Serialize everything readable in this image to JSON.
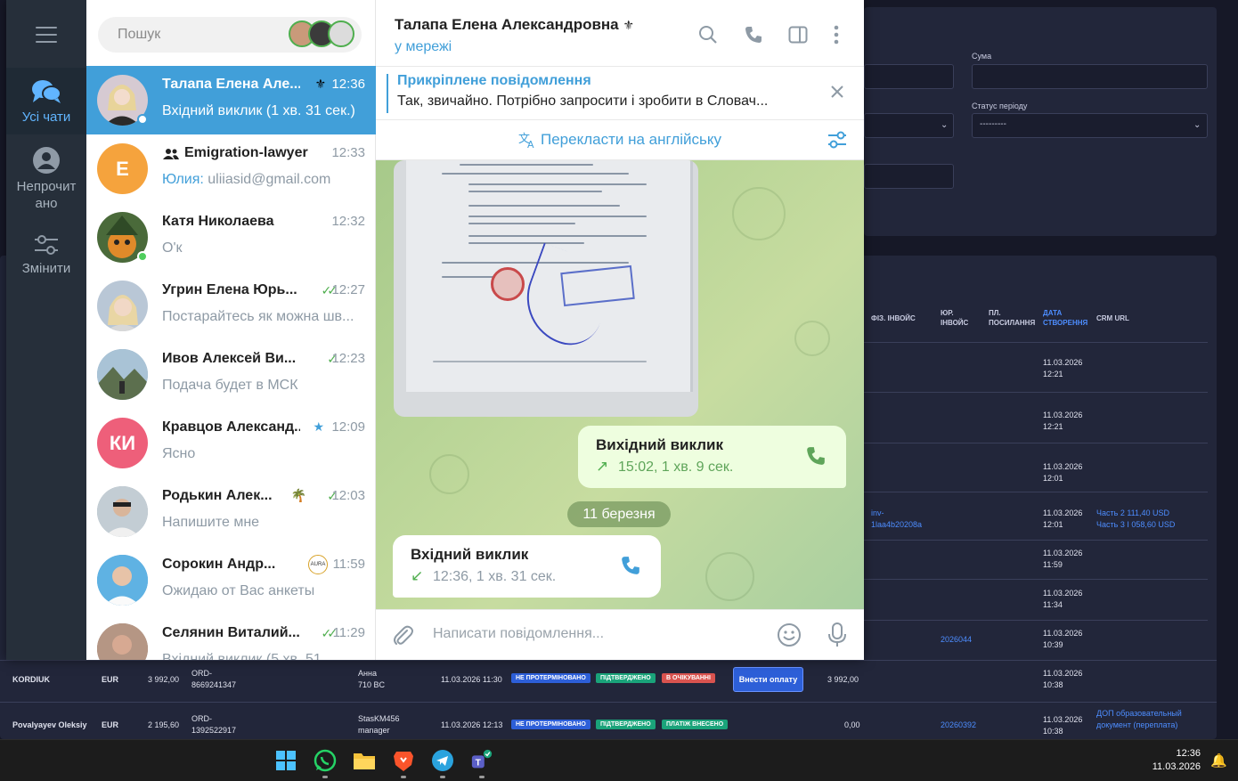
{
  "dashboard": {
    "filter_labels": {
      "sum": "Сума",
      "period_status": "Статус періоду"
    },
    "period_status_value": "---------",
    "columns": {
      "phys_invoice": "ФІЗ. ІНВОЙС",
      "jur_invoice": "ЮР. ІНВОЙС",
      "pay_link": "ПЛ. ПОСИЛАННЯ",
      "created": "ДАТА СТВОРЕННЯ",
      "crm_url": "CRM URL"
    },
    "row_dates": [
      {
        "date": "11.03.2026",
        "time": "12:21"
      },
      {
        "date": "11.03.2026",
        "time": "12:21"
      },
      {
        "date": "11.03.2026",
        "time": "12:01"
      },
      {
        "date": "11.03.2026",
        "time": "12:01"
      },
      {
        "date": "11.03.2026",
        "time": "11:59"
      },
      {
        "date": "11.03.2026",
        "time": "11:34"
      },
      {
        "date": "11.03.2026",
        "time": "10:39"
      },
      {
        "date": "11.03.2026",
        "time": "10:38"
      },
      {
        "date": "11.03.2026",
        "time": "10:38"
      }
    ],
    "inv_link": {
      "line1": "inv-",
      "line2": "1laa4b20208a"
    },
    "crm_parts": {
      "line1": "Часть 2 111,40 USD",
      "line2": "Часть 3 I 058,60 USD"
    },
    "jur_links": {
      "row7": "2026044",
      "row9": "20260392"
    },
    "crm_last": {
      "line1": "ДОП образовательный",
      "line2": "документ (переплата)"
    },
    "rows": [
      {
        "client": "KORDIUK",
        "currency": "EUR",
        "amount": "3 992,00",
        "order": "ORD-",
        "order_id": "8669241347",
        "manager": "Анна",
        "manager2": "710 BC",
        "datetime": "11.03.2026 11:30",
        "badges": [
          "НЕ ПРОТЕРМІНОВАНО",
          "ПІДТВЕРДЖЕНО",
          "В ОЧІКУВАННІ"
        ],
        "pay_button": "Внести оплату",
        "paid": "3 992,00"
      },
      {
        "client": "Povalyayev Oleksiy",
        "currency": "EUR",
        "amount": "2 195,60",
        "order": "ORD-",
        "order_id": "1392522917",
        "manager": "StasKM456",
        "manager2": "manager",
        "datetime": "11.03.2026 12:13",
        "badges": [
          "НЕ ПРОТЕРМІНОВАНО",
          "ПІДТВЕРДЖЕНО",
          "ПЛАТІЖ ВНЕСЕНО"
        ],
        "paid": "0,00"
      }
    ]
  },
  "telegram": {
    "rail": {
      "all_chats": "Усі чати",
      "unread": "Непрочитано",
      "unread_l1": "Непрочит",
      "unread_l2": "ано",
      "edit": "Змінити"
    },
    "search_placeholder": "Пошук",
    "chats": [
      {
        "name": "Талапа Елена Але...",
        "time": "12:36",
        "preview": "Вхідний виклик (1 хв. 31 сек.)",
        "initials": "",
        "avatar_color": "#c9b8c4",
        "online": true,
        "active": true,
        "badge": "laurel-icon"
      },
      {
        "name": "Emigration-lawyer",
        "time": "12:33",
        "preview_sender": "Юлия:",
        "preview": "uliiasid@gmail.com",
        "initials": "E",
        "avatar_color": "#f5a33d",
        "group": true
      },
      {
        "name": "Катя Николаева",
        "time": "12:32",
        "preview": "О'к",
        "initials": "",
        "avatar_color": "#6a9a4a",
        "online": true
      },
      {
        "name": "Угрин Елена Юрь...",
        "time": "12:27",
        "preview": "Постарайтесь як можна шв...",
        "initials": "",
        "avatar_color": "#b9c7d6",
        "read": true
      },
      {
        "name": "Ивов Алексей Ви...",
        "time": "12:23",
        "preview": "Подача будет в МСК",
        "initials": "",
        "avatar_color": "#6f8aa0",
        "sent": true
      },
      {
        "name": "Кравцов Александ...",
        "time": "12:09",
        "preview": "Ясно",
        "initials": "КИ",
        "avatar_color": "#ee5f7a",
        "star": true
      },
      {
        "name": "Родькин Алек...",
        "time": "12:03",
        "preview": "Напишите мне",
        "initials": "",
        "avatar_color": "#7a8c9a",
        "palm": true,
        "sent": true
      },
      {
        "name": "Сорокин Андр...",
        "time": "11:59",
        "preview": "Ожидаю от Вас анкеты",
        "initials": "",
        "avatar_color": "#4aa0d8",
        "aura": "AURA"
      },
      {
        "name": "Селянин Виталий...",
        "time": "11:29",
        "preview": "Вхідний виклик (5 хв. 51...",
        "initials": "",
        "avatar_color": "#8a6a5a",
        "read": true
      }
    ],
    "header": {
      "name": "Талапа Елена Александровна",
      "status": "у мережі"
    },
    "pinned": {
      "title": "Прикріплене повідомлення",
      "text": "Так, звичайно. Потрібно запросити і зробити в Словач..."
    },
    "translate_label": "Перекласти на англійську",
    "messages": {
      "outgoing_call": {
        "title": "Вихідний виклик",
        "info": "15:02, 1 хв. 9 сек."
      },
      "date_separator": "11 березня",
      "incoming_call": {
        "title": "Вхідний виклик",
        "info": "12:36, 1 хв. 31 сек."
      }
    },
    "composer_placeholder": "Написати повідомлення..."
  },
  "taskbar": {
    "apps": [
      "windows-start-icon",
      "whatsapp-icon",
      "file-explorer-icon",
      "brave-icon",
      "telegram-icon",
      "teams-icon"
    ],
    "time": "12:36",
    "date": "11.03.2026"
  }
}
